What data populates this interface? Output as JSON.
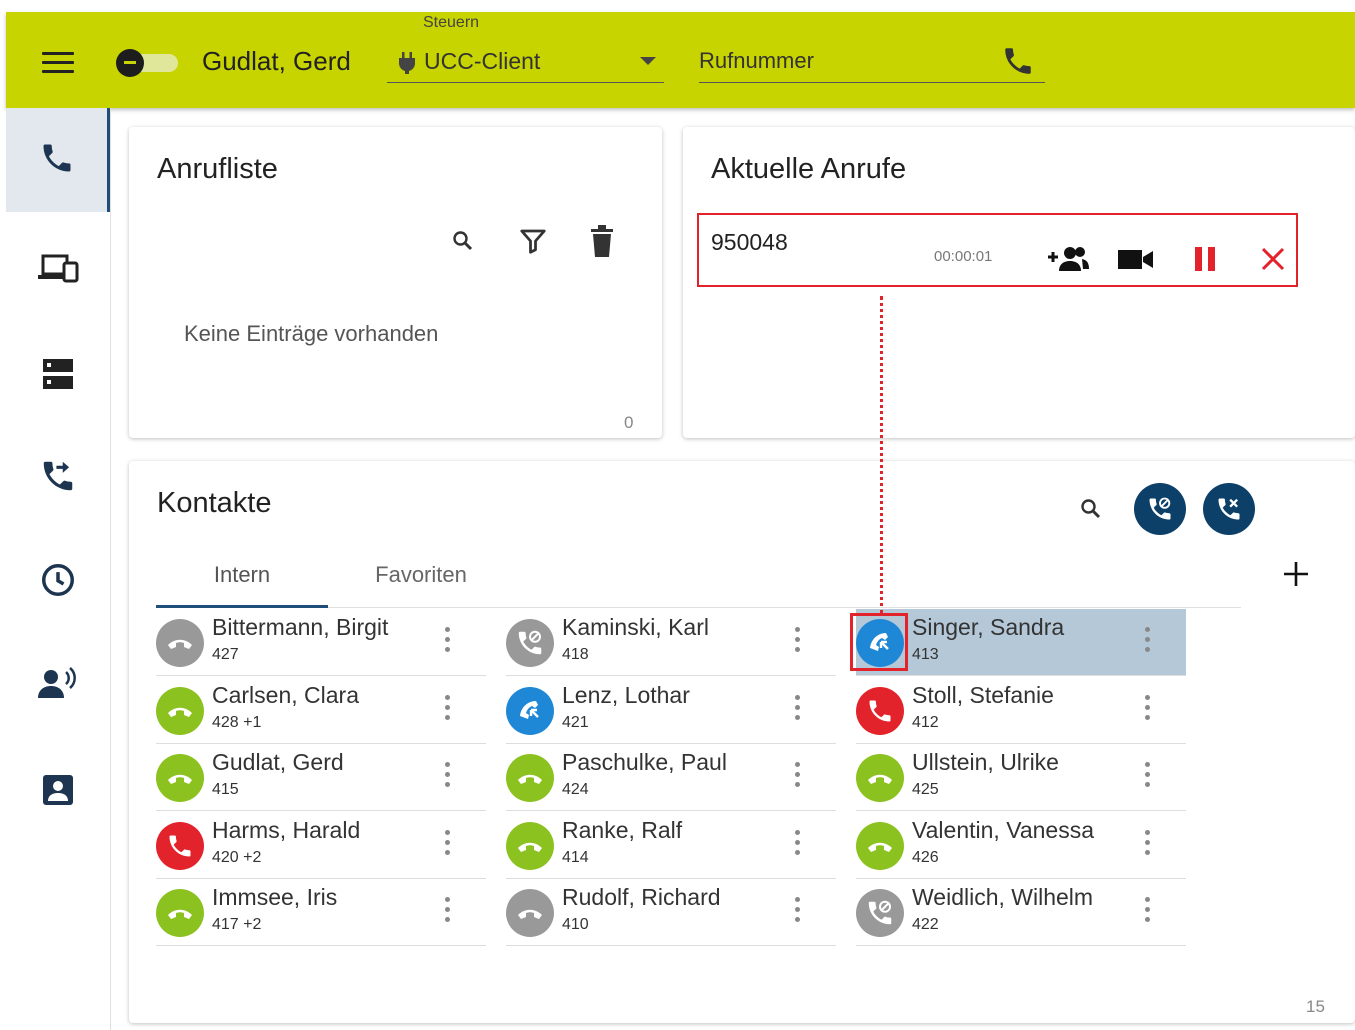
{
  "header": {
    "user_name": "Gudlat, Gerd",
    "control_label": "Steuern",
    "control_value": "UCC-Client",
    "phone_placeholder": "Rufnummer"
  },
  "sidebar": {
    "items": [
      {
        "icon": "phone-icon",
        "active": true
      },
      {
        "icon": "devices-icon"
      },
      {
        "icon": "server-icon"
      },
      {
        "icon": "call-forward-icon"
      },
      {
        "icon": "clock-icon"
      },
      {
        "icon": "voicemail-icon"
      },
      {
        "icon": "contact-card-icon"
      }
    ]
  },
  "call_list": {
    "title": "Anrufliste",
    "empty_text": "Keine Einträge vorhanden",
    "count": "0"
  },
  "current_calls": {
    "title": "Aktuelle Anrufe",
    "calls": [
      {
        "number": "950048",
        "duration": "00:00:01"
      }
    ]
  },
  "contacts": {
    "title": "Kontakte",
    "tabs": [
      "Intern",
      "Favoriten"
    ],
    "active_tab": "Intern",
    "count": "15",
    "list": [
      {
        "name": "Bittermann, Birgit",
        "ext": "427",
        "status": "grey"
      },
      {
        "name": "Carlsen, Clara",
        "ext": "428 +1",
        "status": "green"
      },
      {
        "name": "Gudlat, Gerd",
        "ext": "415",
        "status": "green"
      },
      {
        "name": "Harms, Harald",
        "ext": "420 +2",
        "status": "red"
      },
      {
        "name": "Immsee, Iris",
        "ext": "417 +2",
        "status": "green"
      },
      {
        "name": "Kaminski, Karl",
        "ext": "418",
        "status": "grey-dnd"
      },
      {
        "name": "Lenz, Lothar",
        "ext": "421",
        "status": "blue"
      },
      {
        "name": "Paschulke, Paul",
        "ext": "424",
        "status": "green"
      },
      {
        "name": "Ranke, Ralf",
        "ext": "414",
        "status": "green"
      },
      {
        "name": "Rudolf, Richard",
        "ext": "410",
        "status": "grey"
      },
      {
        "name": "Singer, Sandra",
        "ext": "413",
        "status": "blue",
        "selected": true
      },
      {
        "name": "Stoll, Stefanie",
        "ext": "412",
        "status": "red"
      },
      {
        "name": "Ullstein, Ulrike",
        "ext": "425",
        "status": "green"
      },
      {
        "name": "Valentin, Vanessa",
        "ext": "426",
        "status": "green"
      },
      {
        "name": "Weidlich, Wilhelm",
        "ext": "422",
        "status": "grey-dnd"
      }
    ]
  },
  "colors": {
    "header_bg": "#c8d400",
    "accent": "#0d4069",
    "busy_red": "#e3232c",
    "available_green": "#8cc21f",
    "ringing_blue": "#1f88d6",
    "offline_grey": "#999999"
  }
}
